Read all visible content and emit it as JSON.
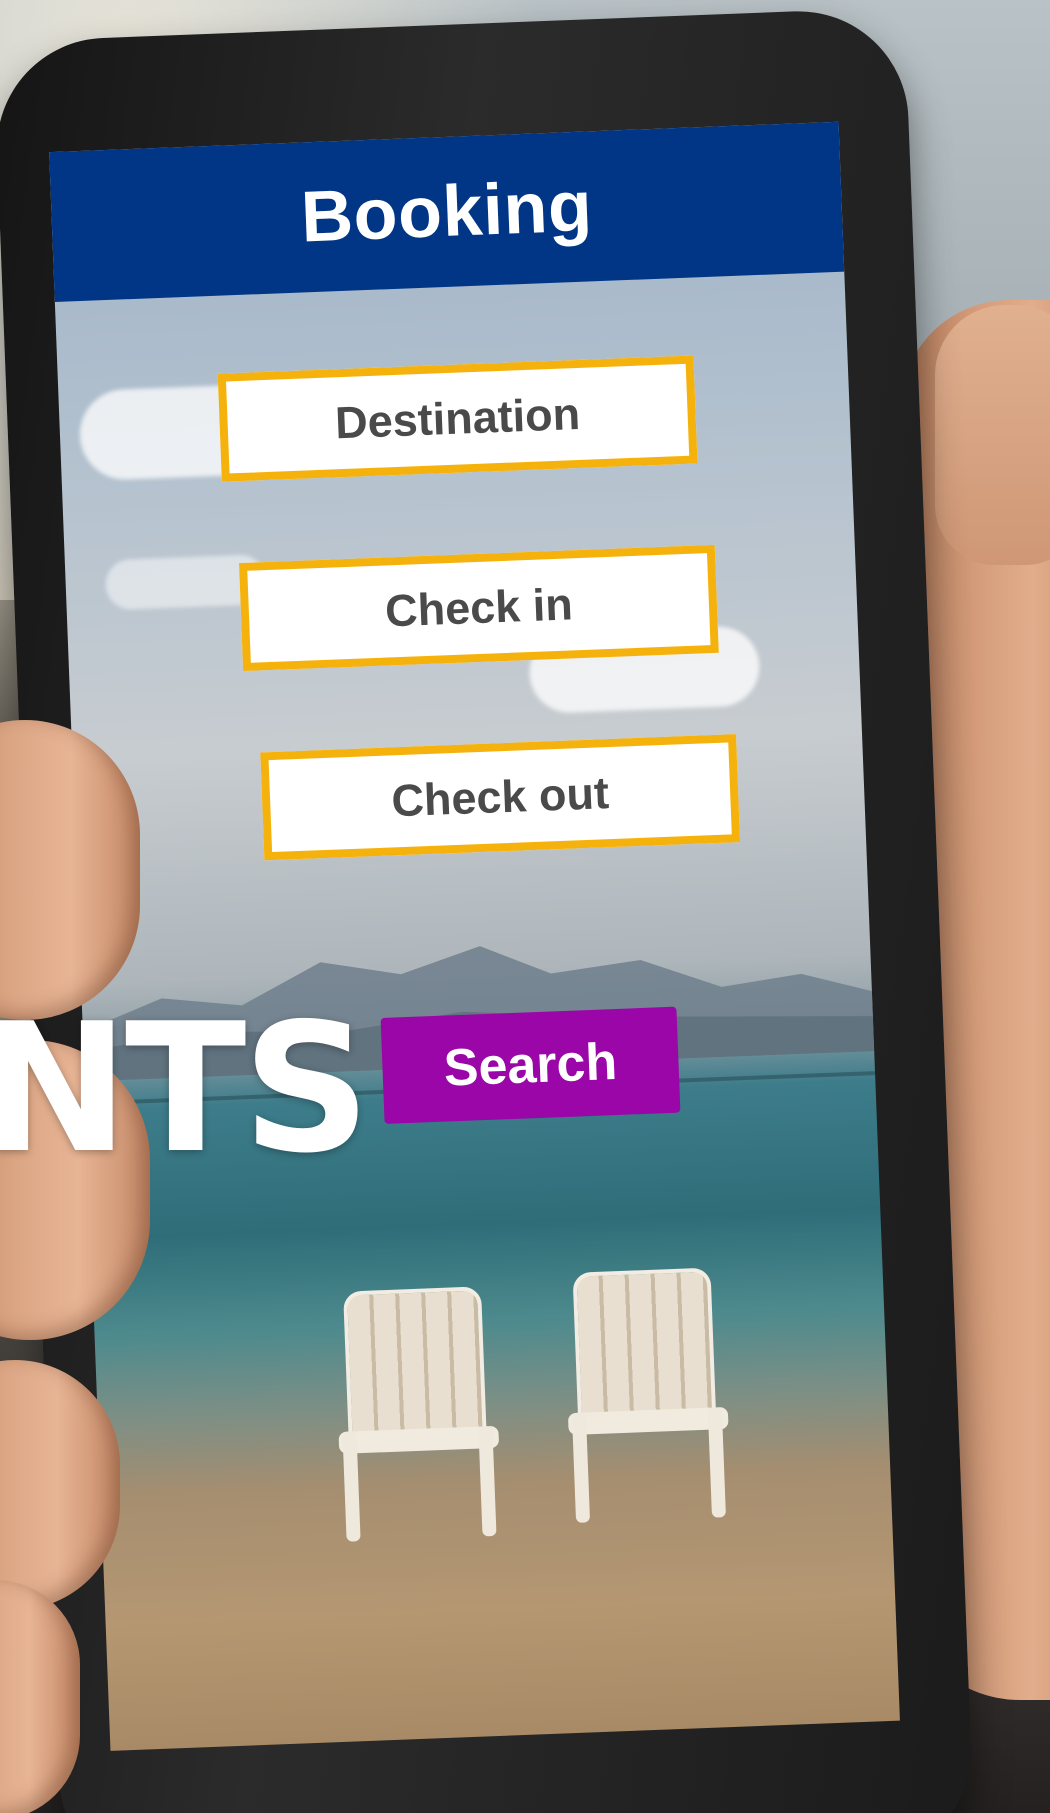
{
  "app": {
    "title": "Booking",
    "colors": {
      "header": "#013586",
      "field_border": "#f5b20c",
      "search_button": "#9a06a8",
      "field_text": "#4a4a4a"
    }
  },
  "form": {
    "destination_placeholder": "Destination",
    "checkin_placeholder": "Check in",
    "checkout_placeholder": "Check out",
    "search_label": "Search"
  },
  "overlay": {
    "text": "NTS"
  }
}
